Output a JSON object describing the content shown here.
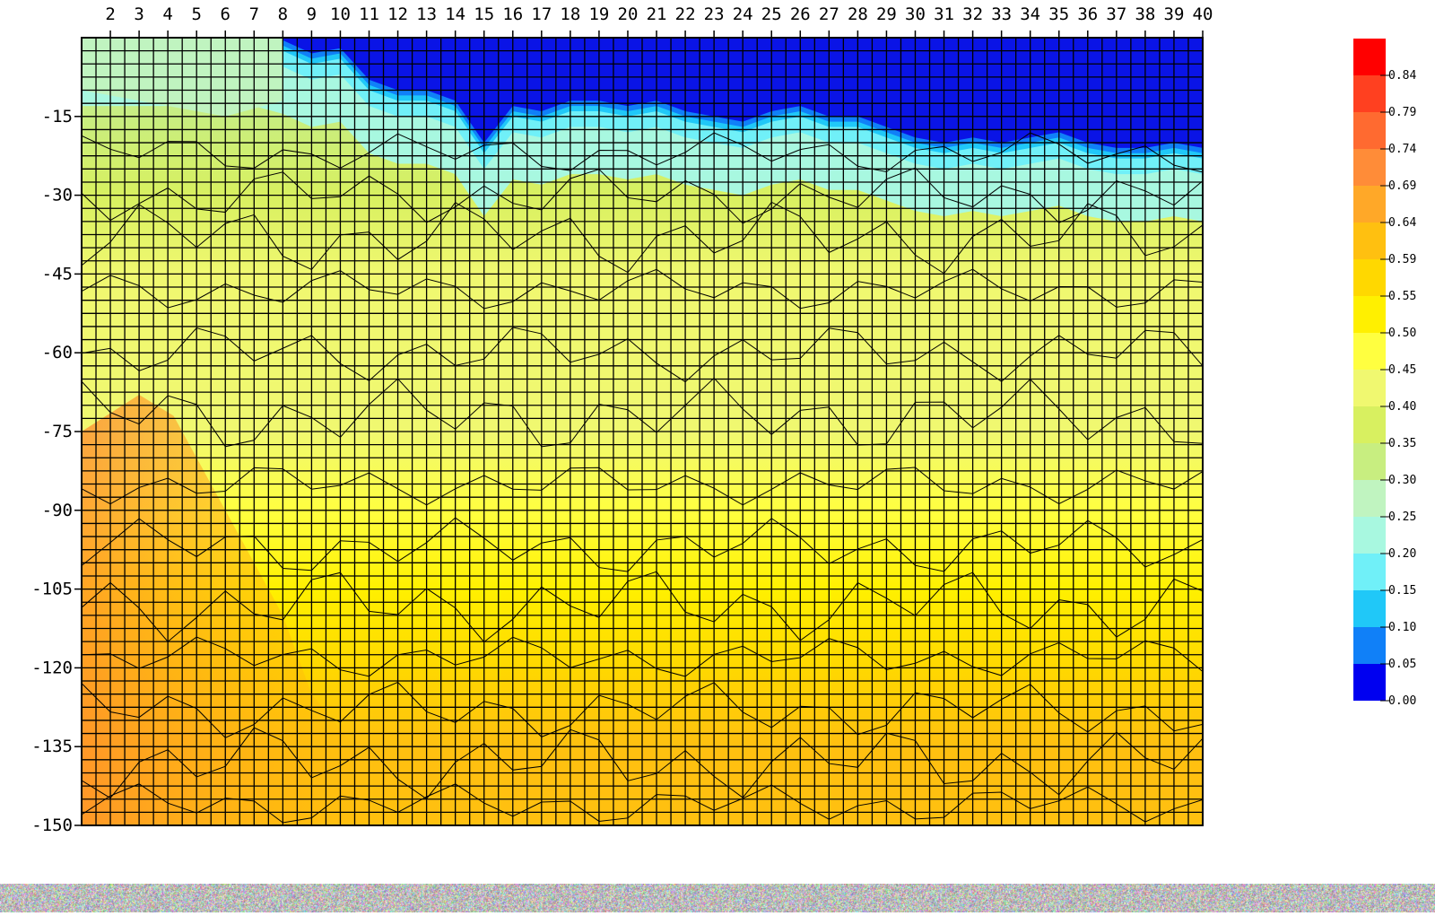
{
  "chart_data": {
    "type": "heatmap",
    "title": "",
    "xlabel": "",
    "ylabel": "",
    "x_ticks": [
      "2",
      "3",
      "4",
      "5",
      "6",
      "7",
      "8",
      "9",
      "10",
      "11",
      "12",
      "13",
      "14",
      "15",
      "16",
      "17",
      "18",
      "19",
      "20",
      "21",
      "22",
      "23",
      "24",
      "25",
      "26",
      "27",
      "28",
      "29",
      "30",
      "31",
      "32",
      "33",
      "34",
      "35",
      "36",
      "37",
      "38",
      "39",
      "40"
    ],
    "y_ticks": [
      "-15",
      "-30",
      "-45",
      "-60",
      "-75",
      "-90",
      "-105",
      "-120",
      "-135",
      "-150"
    ],
    "xlim": [
      1,
      40
    ],
    "ylim": [
      -150,
      0
    ],
    "grid": true,
    "legend": {
      "placement": "right",
      "labels": [
        "0.84",
        "0.79",
        "0.74",
        "0.69",
        "0.64",
        "0.59",
        "0.55",
        "0.50",
        "0.45",
        "0.40",
        "0.35",
        "0.30",
        "0.25",
        "0.20",
        "0.15",
        "0.10",
        "0.05",
        "0.00"
      ],
      "colors": [
        "#ff0000",
        "#ff4020",
        "#ff6a30",
        "#ff8c38",
        "#ffa828",
        "#ffc010",
        "#ffd800",
        "#fff000",
        "#ffff40",
        "#f0f870",
        "#d8f060",
        "#c8ee80",
        "#c0f4c0",
        "#a8f8e0",
        "#70f0f8",
        "#20c8f8",
        "#1080f8",
        "#0000f0"
      ]
    },
    "depth_profile": [
      {
        "depth": 0,
        "value": 0.26
      },
      {
        "depth": -15,
        "value": 0.33
      },
      {
        "depth": -30,
        "value": 0.37
      },
      {
        "depth": -45,
        "value": 0.4
      },
      {
        "depth": -60,
        "value": 0.42
      },
      {
        "depth": -75,
        "value": 0.44
      },
      {
        "depth": -90,
        "value": 0.47
      },
      {
        "depth": -105,
        "value": 0.52
      },
      {
        "depth": -120,
        "value": 0.56
      },
      {
        "depth": -135,
        "value": 0.6
      },
      {
        "depth": -150,
        "value": 0.63
      }
    ]
  },
  "colors": {
    "blue_top": "#0a14e6",
    "cyan": "#70f0f8",
    "aqua": "#a8f8e0",
    "mint": "#c0f4c0",
    "light_green": "#c8ee80",
    "green": "#d4f070",
    "pale_yellow": "#f4f88a",
    "yellow": "#fff000",
    "gold": "#ffd000",
    "orange": "#ffb010",
    "deep_orange": "#ff8a30"
  }
}
